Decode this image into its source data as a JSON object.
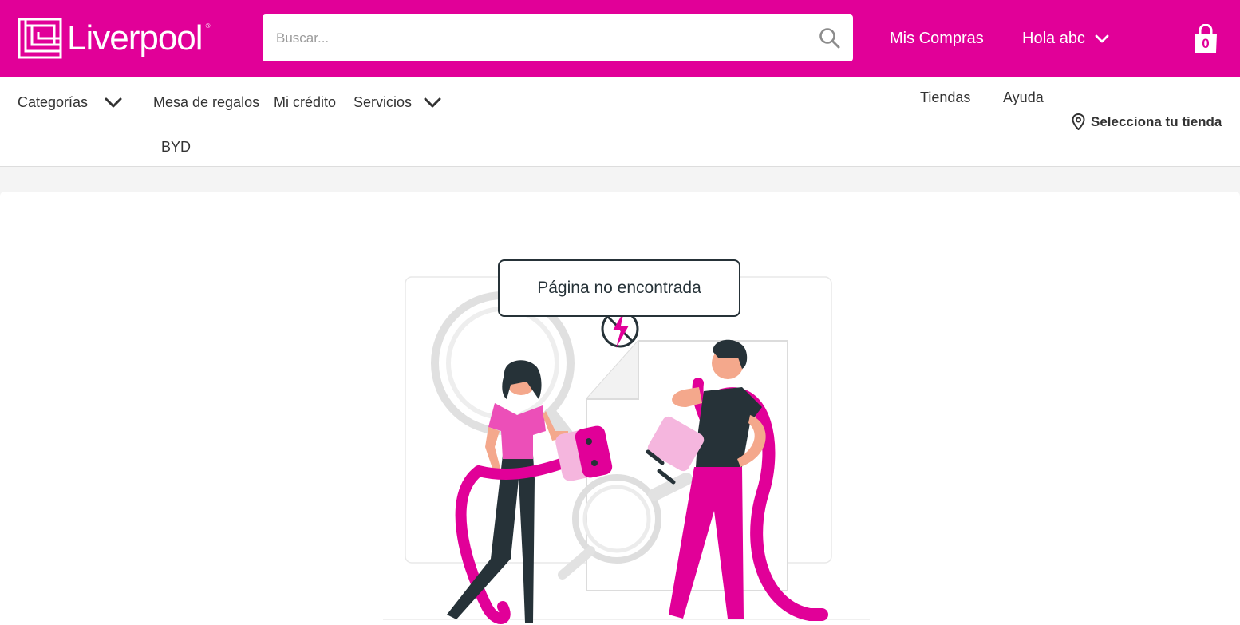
{
  "header": {
    "logo_text": "Liverpool",
    "logo_mark": "®",
    "search_placeholder": "Buscar...",
    "mis_compras": "Mis Compras",
    "greeting": "Hola abc",
    "cart_count": "0",
    "brand_color": "#e10098"
  },
  "subnav": {
    "categorias": "Categorías",
    "mesa": "Mesa de regalos",
    "credito": "Mi crédito",
    "servicios": "Servicios",
    "byd": "BYD",
    "tiendas": "Tiendas",
    "ayuda": "Ayuda",
    "selecciona": "Selecciona tu tienda"
  },
  "error": {
    "message": "Página no encontrada"
  },
  "icons": [
    "liverpool-logo-icon",
    "search-icon",
    "chevron-down-icon",
    "shopping-bag-icon",
    "location-pin-icon",
    "no-power-icon"
  ]
}
